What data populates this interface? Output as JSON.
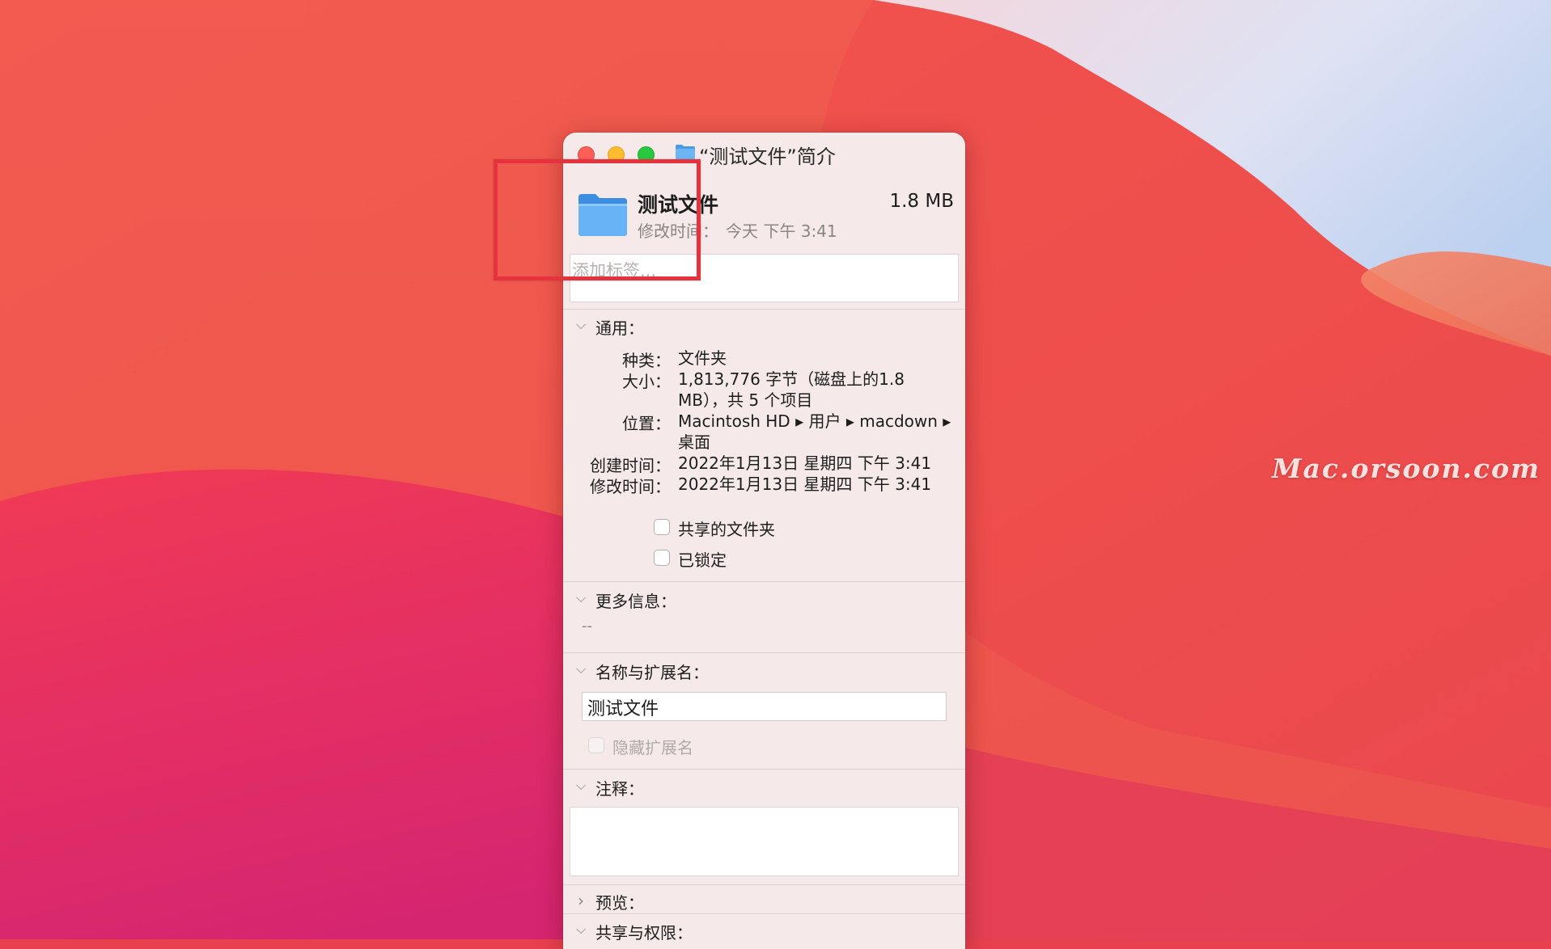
{
  "watermark": "Mac.orsoon.com",
  "window": {
    "title": "“测试文件”简介",
    "file_name": "测试文件",
    "file_size": "1.8 MB",
    "modified_label": "修改时间：",
    "modified_value": "今天 下午 3:41",
    "tag_placeholder": "添加标签..."
  },
  "general": {
    "title": "通用：",
    "rows": [
      {
        "label": "种类：",
        "value": "文件夹"
      },
      {
        "label": "大小：",
        "value": "1,813,776 字节（磁盘上的1.8 MB），共 5 个项目"
      },
      {
        "label": "位置：",
        "value": "Macintosh HD ▸ 用户 ▸ macdown ▸ 桌面"
      },
      {
        "label": "创建时间：",
        "value": "2022年1月13日 星期四 下午 3:41"
      },
      {
        "label": "修改时间：",
        "value": "2022年1月13日 星期四 下午 3:41"
      }
    ],
    "shared_folder": {
      "label": "共享的文件夹",
      "checked": false
    },
    "locked": {
      "label": "已锁定",
      "checked": false
    }
  },
  "more_info": {
    "title": "更多信息：",
    "value": "--"
  },
  "name_ext": {
    "title": "名称与扩展名：",
    "value": "测试文件",
    "hide_ext": {
      "label": "隐藏扩展名",
      "checked": false,
      "disabled": true
    }
  },
  "comments": {
    "title": "注释：",
    "value": ""
  },
  "preview": {
    "title": "预览："
  },
  "sharing": {
    "title": "共享与权限："
  },
  "colors": {
    "accent_highlight": "#e5323c",
    "folder_blue": "#5aaaf0",
    "window_bg": "#f5eae9"
  },
  "icons": {
    "chevron_expanded": "chevron-down-icon",
    "chevron_collapsed": "chevron-right-icon"
  }
}
